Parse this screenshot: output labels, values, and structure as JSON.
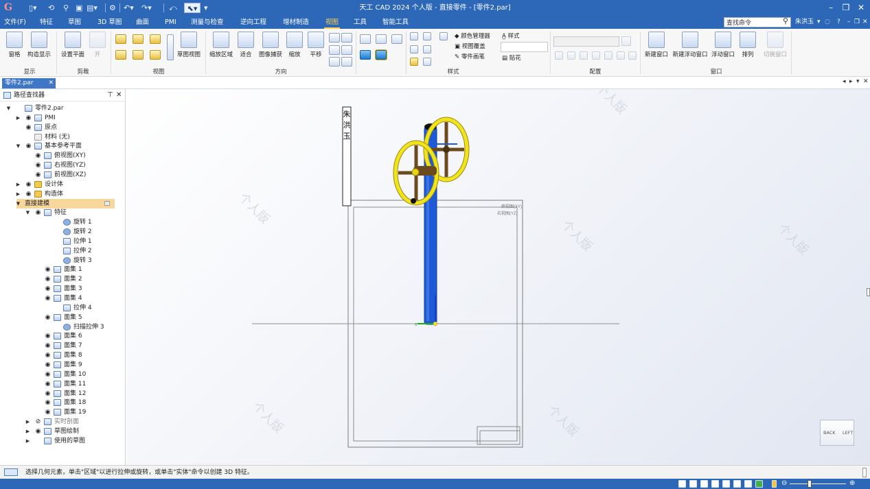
{
  "app": {
    "title": "天工 CAD 2024 个人版 - 直接零件 - [零件2.par]",
    "logo": "G",
    "user": "朱洪玉",
    "search_placeholder": "查找命令"
  },
  "menu": [
    "文件(F)",
    "特征",
    "草图",
    "3D 草图",
    "曲面",
    "PMI",
    "测量与检查",
    "逆向工程",
    "增材制造",
    "视图",
    "工具",
    "智能工具"
  ],
  "menu_active_index": 9,
  "ribbon": {
    "display": {
      "buttons": [
        "窗格",
        "构造显示"
      ],
      "label": "显示"
    },
    "clip": {
      "buttons": [
        "设置平面",
        "开"
      ],
      "label": "剪裁"
    },
    "view": {
      "buttons": [
        "草图视图"
      ],
      "label": "视图"
    },
    "orient": {
      "buttons": [
        "缩放区域",
        "适合",
        "图像捕获",
        "缩放",
        "平移"
      ],
      "label": "方向"
    },
    "style": {
      "items": [
        "颜色管理器",
        "视图覆盖",
        "零件画笔",
        "样式",
        "贴花"
      ],
      "label": "样式"
    },
    "config": {
      "label": "配置"
    },
    "window": {
      "buttons": [
        "新建窗口",
        "新建浮动窗口",
        "浮动窗口",
        "排列",
        "切换窗口"
      ],
      "label": "窗口"
    }
  },
  "doc_tab": "零件2.par",
  "pathfinder": {
    "title": "路径查找器",
    "tree": [
      {
        "label": "零件2.par",
        "depth": 0,
        "toggle": "▼",
        "eye": false,
        "icon": "part"
      },
      {
        "label": "PMI",
        "depth": 1,
        "toggle": "▶",
        "eye": true,
        "icon": "pmi"
      },
      {
        "label": "原点",
        "depth": 1,
        "toggle": "",
        "eye": true,
        "icon": "origin"
      },
      {
        "label": "材料 (无)",
        "depth": 1,
        "toggle": "",
        "eye": false,
        "icon": "material"
      },
      {
        "label": "基本参考平面",
        "depth": 1,
        "toggle": "▼",
        "eye": true,
        "icon": "plane"
      },
      {
        "label": "俯视图(XY)",
        "depth": 2,
        "toggle": "",
        "eye": true,
        "icon": "plane"
      },
      {
        "label": "右视图(YZ)",
        "depth": 2,
        "toggle": "",
        "eye": true,
        "icon": "plane"
      },
      {
        "label": "前视图(XZ)",
        "depth": 2,
        "toggle": "",
        "eye": true,
        "icon": "plane"
      },
      {
        "label": "设计体",
        "depth": 1,
        "toggle": "▶",
        "eye": true,
        "icon": "body"
      },
      {
        "label": "构造体",
        "depth": 1,
        "toggle": "▶",
        "eye": true,
        "icon": "body"
      },
      {
        "label": "直接建模",
        "depth": 1,
        "toggle": "▼",
        "eye": false,
        "icon": "",
        "selected": true
      },
      {
        "label": "特征",
        "depth": 2,
        "toggle": "▼",
        "eye": true,
        "icon": "feature"
      },
      {
        "label": "旋转 1",
        "depth": 4,
        "toggle": "",
        "eye": false,
        "icon": "gear"
      },
      {
        "label": "旋转 2",
        "depth": 4,
        "toggle": "",
        "eye": false,
        "icon": "gear"
      },
      {
        "label": "拉伸 1",
        "depth": 4,
        "toggle": "",
        "eye": false,
        "icon": "extrude"
      },
      {
        "label": "拉伸 2",
        "depth": 4,
        "toggle": "",
        "eye": false,
        "icon": "extrude"
      },
      {
        "label": "旋转 3",
        "depth": 4,
        "toggle": "",
        "eye": false,
        "icon": "gear"
      },
      {
        "label": "面集 1",
        "depth": 3,
        "toggle": "",
        "eye": true,
        "icon": "face"
      },
      {
        "label": "面集 2",
        "depth": 3,
        "toggle": "",
        "eye": true,
        "icon": "face"
      },
      {
        "label": "面集 3",
        "depth": 3,
        "toggle": "",
        "eye": true,
        "icon": "face"
      },
      {
        "label": "面集 4",
        "depth": 3,
        "toggle": "",
        "eye": true,
        "icon": "face"
      },
      {
        "label": "拉伸 4",
        "depth": 4,
        "toggle": "",
        "eye": false,
        "icon": "extrude"
      },
      {
        "label": "面集 5",
        "depth": 3,
        "toggle": "",
        "eye": true,
        "icon": "face"
      },
      {
        "label": "扫描拉伸 3",
        "depth": 4,
        "toggle": "",
        "eye": false,
        "icon": "sweep"
      },
      {
        "label": "面集 6",
        "depth": 3,
        "toggle": "",
        "eye": true,
        "icon": "face"
      },
      {
        "label": "面集 7",
        "depth": 3,
        "toggle": "",
        "eye": true,
        "icon": "face"
      },
      {
        "label": "面集 8",
        "depth": 3,
        "toggle": "",
        "eye": true,
        "icon": "face"
      },
      {
        "label": "面集 9",
        "depth": 3,
        "toggle": "",
        "eye": true,
        "icon": "face"
      },
      {
        "label": "面集 10",
        "depth": 3,
        "toggle": "",
        "eye": true,
        "icon": "face"
      },
      {
        "label": "面集 11",
        "depth": 3,
        "toggle": "",
        "eye": true,
        "icon": "face"
      },
      {
        "label": "面集 12",
        "depth": 3,
        "toggle": "",
        "eye": true,
        "icon": "face"
      },
      {
        "label": "面集 18",
        "depth": 3,
        "toggle": "",
        "eye": true,
        "icon": "face"
      },
      {
        "label": "面集 19",
        "depth": 3,
        "toggle": "",
        "eye": true,
        "icon": "face"
      },
      {
        "label": "实时剖面",
        "depth": 2,
        "toggle": "▶",
        "eye": true,
        "icon": "section",
        "gray": true
      },
      {
        "label": "草图绘制",
        "depth": 2,
        "toggle": "▶",
        "eye": true,
        "icon": "sketch"
      },
      {
        "label": "使用的草图",
        "depth": 2,
        "toggle": "▶",
        "eye": false,
        "icon": "sketch"
      }
    ]
  },
  "viewport": {
    "vertical_text": "朱洪玉",
    "plane_label_1": "俯视图(XY)",
    "plane_label_2": "右视图(YZ)",
    "watermark": "个人版",
    "view_cube": {
      "left": "BACK",
      "right": "LEFT"
    },
    "colors": {
      "post": "#1e5ad8",
      "wheel": "#f2e41c",
      "spoke": "#6b4a1e"
    }
  },
  "status": {
    "message": "选择几何元素，单击\"区域\"以进行拉伸或旋转，或单击\"实体\"命令以创建 3D 特征。"
  }
}
